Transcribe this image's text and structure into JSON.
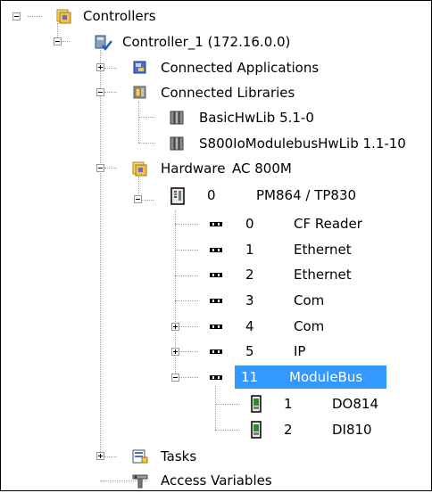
{
  "tree": {
    "root": {
      "label": "Controllers",
      "icon": "controllers-icon",
      "expanded": true
    },
    "controller": {
      "label": "Controller_1 (172.16.0.0)",
      "icon": "controller-check-icon",
      "expanded": true
    },
    "connected_applications": {
      "label": "Connected Applications",
      "icon": "application-icon",
      "expanded": false
    },
    "connected_libraries": {
      "label": "Connected Libraries",
      "icon": "library-icon",
      "expanded": true,
      "items": [
        {
          "label": "BasicHwLib 5.1-0",
          "icon": "library-book-icon"
        },
        {
          "label": "S800IoModulebusHwLib 1.1-10",
          "icon": "library-book-icon"
        }
      ]
    },
    "hardware": {
      "label": "Hardware",
      "platform": "AC 800M",
      "icon": "hardware-icon",
      "expanded": true,
      "cpu": {
        "position": "0",
        "name": "PM864 / TP830",
        "icon": "cpu-unit-icon",
        "expanded": true,
        "channels": [
          {
            "position": "0",
            "name": "CF Reader",
            "expandable": false
          },
          {
            "position": "1",
            "name": "Ethernet",
            "expandable": false
          },
          {
            "position": "2",
            "name": "Ethernet",
            "expandable": false
          },
          {
            "position": "3",
            "name": "Com",
            "expandable": false
          },
          {
            "position": "4",
            "name": "Com",
            "expandable": true
          },
          {
            "position": "5",
            "name": "IP",
            "expandable": true
          },
          {
            "position": "11",
            "name": "ModuleBus",
            "expandable": true,
            "expanded": true,
            "selected": true
          }
        ],
        "modules": [
          {
            "position": "1",
            "name": "DO814",
            "icon": "io-module-icon"
          },
          {
            "position": "2",
            "name": "DI810",
            "icon": "io-module-icon"
          }
        ]
      }
    },
    "tasks": {
      "label": "Tasks",
      "icon": "tasks-icon",
      "expanded": false
    },
    "access_variables": {
      "label": "Access Variables",
      "icon": "access-variables-icon"
    }
  },
  "colors": {
    "selection": "#3399ff",
    "selection_text": "#ffffff",
    "connector": "#a0a0a0"
  }
}
